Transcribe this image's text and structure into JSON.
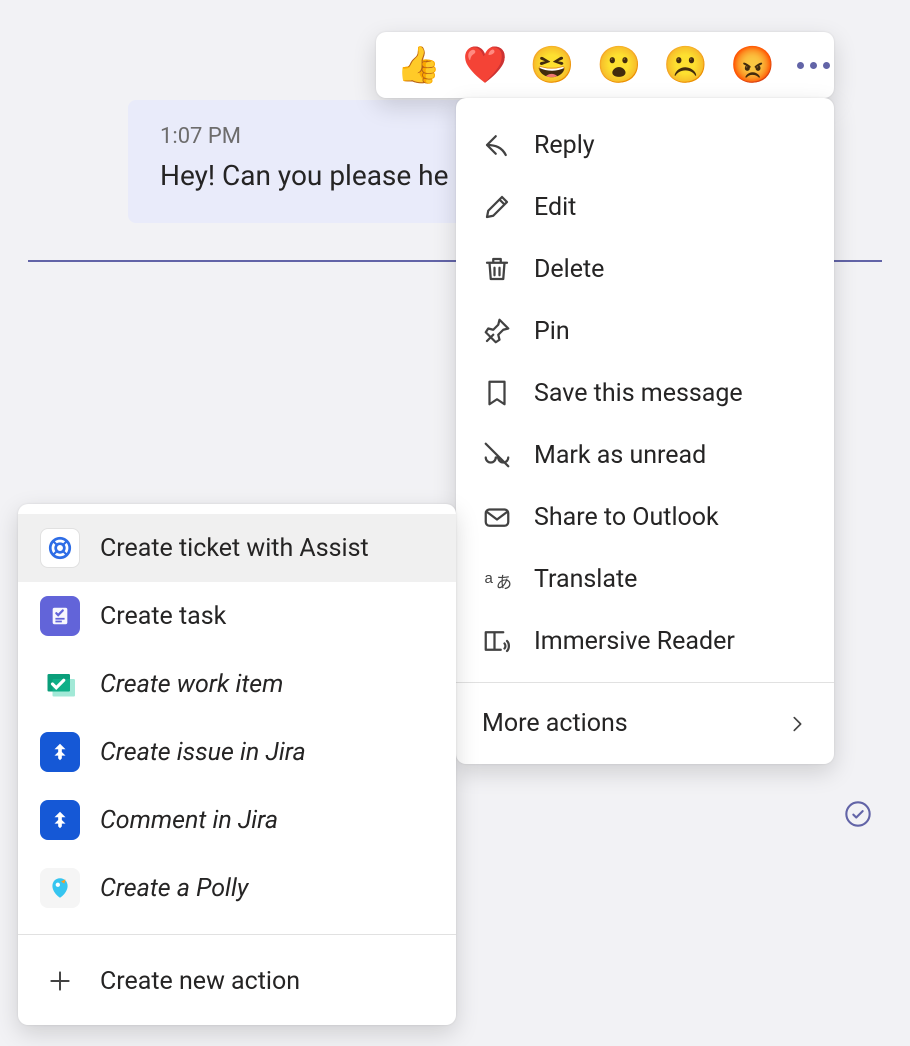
{
  "message": {
    "timestamp": "1:07 PM",
    "body": "Hey! Can you please he"
  },
  "reactions": {
    "like": "👍",
    "heart": "❤️",
    "laugh": "😆",
    "surprised": "😮",
    "sad": "☹️",
    "angry": "😡"
  },
  "context_menu": {
    "reply": "Reply",
    "edit": "Edit",
    "delete": "Delete",
    "pin": "Pin",
    "save": "Save this message",
    "mark_unread": "Mark as unread",
    "share_outlook": "Share to Outlook",
    "translate": "Translate",
    "immersive_reader": "Immersive Reader",
    "more_actions": "More actions"
  },
  "submenu": {
    "assist": "Create ticket with Assist",
    "create_task": "Create task",
    "create_work_item": "Create work item",
    "create_jira_issue": "Create issue in Jira",
    "comment_jira": "Comment in Jira",
    "create_polly": "Create a Polly",
    "create_new_action": "Create new action"
  }
}
